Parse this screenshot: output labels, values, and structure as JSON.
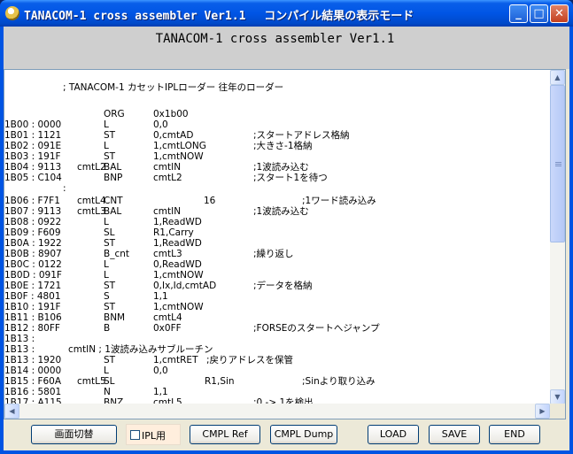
{
  "window": {
    "title": "TANACOM-1 cross assembler Ver1.1　 コンパイル結果の表示モード",
    "minimize": "_",
    "maximize": "□",
    "close": "✕"
  },
  "header": {
    "title": "TANACOM-1 cross assembler Ver1.1"
  },
  "listing": {
    "lines": [
      {
        "addr": "",
        "label": "",
        "op": "",
        "arg": "",
        "comment": "",
        "note": "; TANACOM-1 カセットIPLローダー  往年のローダー"
      },
      {
        "addr": "",
        "label": "",
        "op": "",
        "arg": "",
        "comment": ""
      },
      {
        "addr": "",
        "label": "",
        "op": "ORG",
        "arg": "0x1b00",
        "comment": ""
      },
      {
        "addr": "1B00 : 0000",
        "label": "",
        "op": "L",
        "arg": "0,0",
        "comment": ""
      },
      {
        "addr": "1B01 : 1121",
        "label": "",
        "op": "ST",
        "arg": "0,cmtAD",
        "comment": ";スタートアドレス格納"
      },
      {
        "addr": "1B02 : 091E",
        "label": "",
        "op": "L",
        "arg": "1,cmtLONG",
        "comment": ";大きさ-1格納"
      },
      {
        "addr": "1B03 : 191F",
        "label": "",
        "op": "ST",
        "arg": "1,cmtNOW",
        "comment": ""
      },
      {
        "addr": "1B04 : 9113",
        "label": "cmtL2",
        "op": "BAL",
        "arg": "cmtIN",
        "comment": ";1波読み込む"
      },
      {
        "addr": "1B05 : C104",
        "label": "",
        "op": "BNP",
        "arg": "cmtL2",
        "comment": ";スタート1を待つ"
      },
      {
        "addr": "",
        "label": "",
        "op": "",
        "arg": "",
        "comment": "",
        "dot": ":"
      },
      {
        "addr": "1B06 : F7F1",
        "label": "cmtL4",
        "op": "CNT",
        "arg": "16",
        "comment": ";1ワード読み込み",
        "wide": true
      },
      {
        "addr": "1B07 : 9113",
        "label": "cmtL3",
        "op": "BAL",
        "arg": "cmtIN",
        "comment": ";1波読み込む"
      },
      {
        "addr": "1B08 : 0922",
        "label": "",
        "op": "L",
        "arg": "1,ReadWD",
        "comment": ""
      },
      {
        "addr": "1B09 : F609",
        "label": "",
        "op": "SL",
        "arg": "R1,Carry",
        "comment": ""
      },
      {
        "addr": "1B0A : 1922",
        "label": "",
        "op": "ST",
        "arg": "1,ReadWD",
        "comment": ""
      },
      {
        "addr": "1B0B : 8907",
        "label": "",
        "op": "B_cnt",
        "arg": "cmtL3",
        "comment": ";繰り返し"
      },
      {
        "addr": "1B0C : 0122",
        "label": "",
        "op": "L",
        "arg": "0,ReadWD",
        "comment": ""
      },
      {
        "addr": "1B0D : 091F",
        "label": "",
        "op": "L",
        "arg": "1,cmtNOW",
        "comment": ""
      },
      {
        "addr": "1B0E : 1721",
        "label": "",
        "op": "ST",
        "arg": "0,Ix,Id,cmtAD",
        "comment": ";データを格納"
      },
      {
        "addr": "1B0F : 4801",
        "label": "",
        "op": "S",
        "arg": "1,1",
        "comment": ""
      },
      {
        "addr": "1B10 : 191F",
        "label": "",
        "op": "ST",
        "arg": "1,cmtNOW",
        "comment": ""
      },
      {
        "addr": "1B11 : B106",
        "label": "",
        "op": "BNM",
        "arg": "cmtL4",
        "comment": ""
      },
      {
        "addr": "1B12 : 80FF",
        "label": "",
        "op": "B",
        "arg": "0x0FF",
        "comment": ";FORSEのスタートへジャンプ"
      },
      {
        "addr": "1B13 :",
        "label": "",
        "op": "",
        "arg": "",
        "comment": ""
      },
      {
        "addr": "1B13 :",
        "label": "",
        "op": "",
        "arg": "",
        "comment": "",
        "note2": "cmtIN  ; 1波読み込みサブルーチン"
      },
      {
        "addr": "1B13 : 1920",
        "label": "",
        "op": "ST",
        "arg": "1,cmtRET",
        "comment": ";戻りアドレスを保管",
        "tight": true
      },
      {
        "addr": "1B14 : 0000",
        "label": "",
        "op": "L",
        "arg": "0,0",
        "comment": ""
      },
      {
        "addr": "1B15 : F60A",
        "label": "cmtL5",
        "op": "SL",
        "arg": "R1,Sin",
        "comment": ";Sinより取り込み",
        "sl": true
      },
      {
        "addr": "1B16 : 5801",
        "label": "",
        "op": "N",
        "arg": "1,1",
        "comment": ""
      },
      {
        "addr": "1B17 : A115",
        "label": "",
        "op": "BNZ",
        "arg": "cmtL5",
        "comment": ";0 -> 1を検出"
      }
    ]
  },
  "buttons": {
    "screen_switch": "画面切替",
    "ipl_label": "IPL用",
    "ipl_checked": false,
    "cmpl_ref": "CMPL Ref",
    "cmpl_dump": "CMPL Dump",
    "load": "LOAD",
    "save": "SAVE",
    "end": "END"
  },
  "scrollbar": {
    "up": "▲",
    "down": "▼",
    "left": "◀",
    "right": "▶"
  }
}
